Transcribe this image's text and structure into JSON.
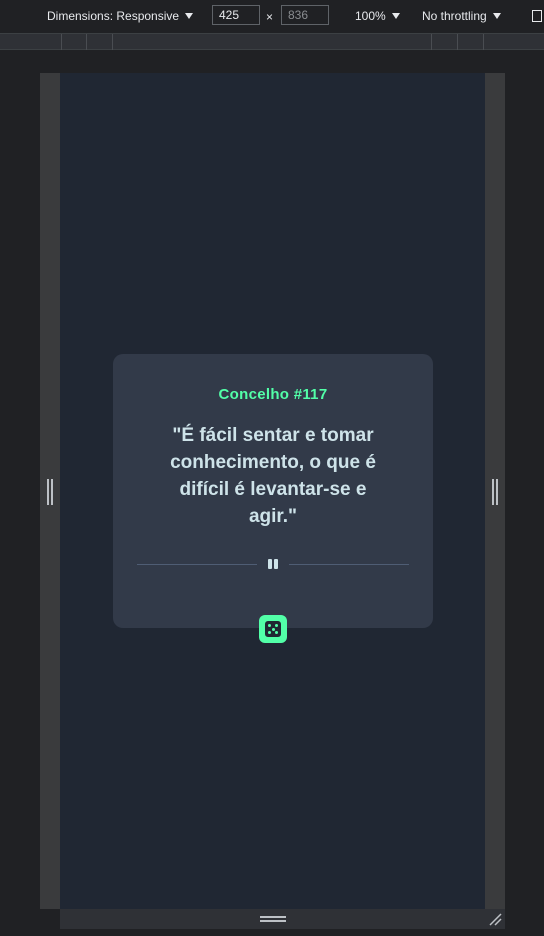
{
  "devtools": {
    "dimensions_label": "Dimensions: Responsive",
    "width_value": "425",
    "height_value": "836",
    "times_sign": "×",
    "zoom_label": "100%",
    "throttling_label": "No throttling"
  },
  "advice": {
    "id_label": "Concelho #117",
    "text": "\"É fácil sentar e tomar conhecimento, o que é difícil é levantar-se e agir.\""
  },
  "colors": {
    "background": "#202733",
    "card": "#323a49",
    "accent": "#52ffa8",
    "text": "#cee3e9",
    "divider": "#4f5d74"
  },
  "icons": {
    "divider": "pause-icon",
    "generate": "dice-icon"
  }
}
